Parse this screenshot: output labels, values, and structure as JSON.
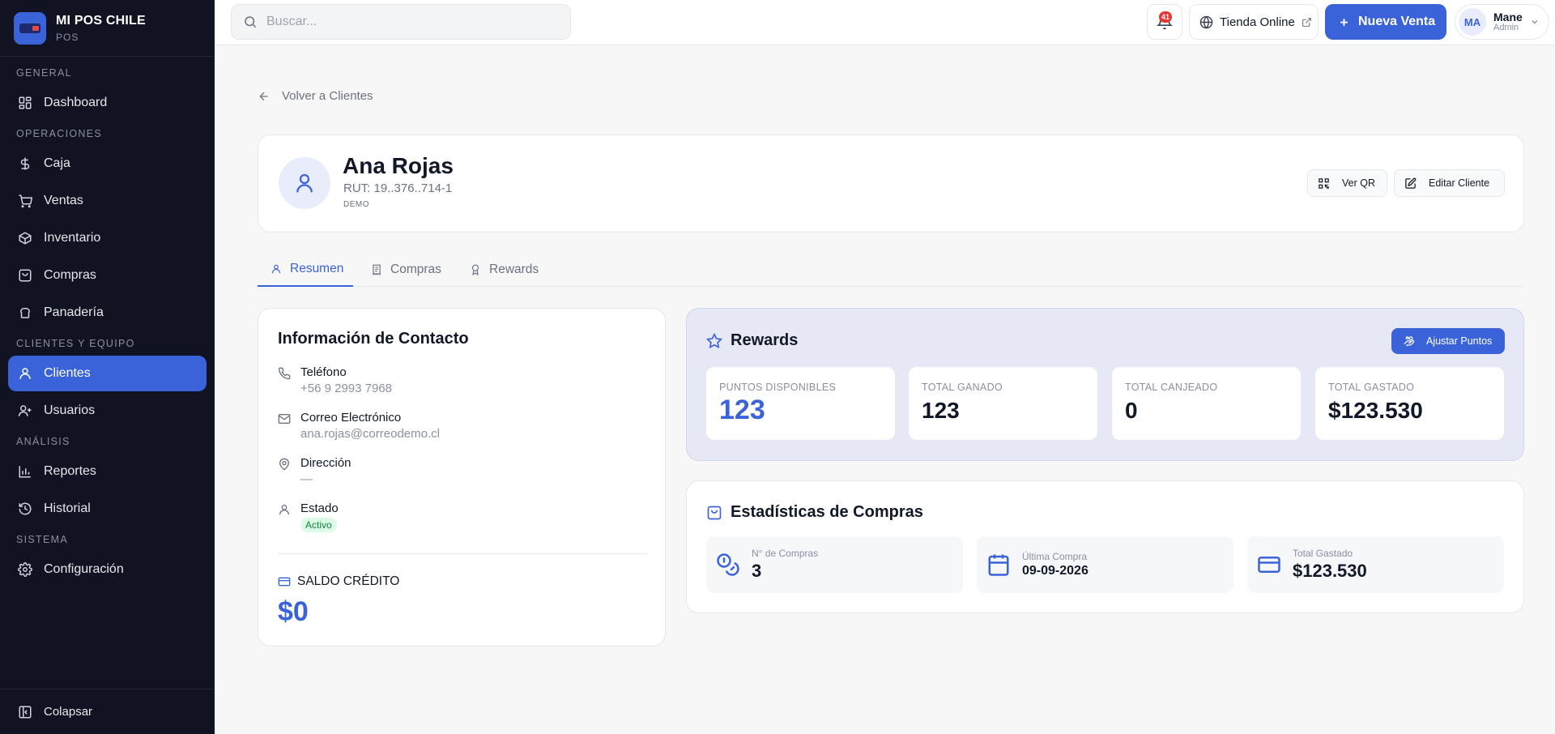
{
  "brand": {
    "name": "MI POS CHILE",
    "subtitle": "POS"
  },
  "sidebar": {
    "sections": [
      {
        "label": "GENERAL"
      },
      {
        "label": "OPERACIONES"
      },
      {
        "label": "CLIENTES Y EQUIPO"
      },
      {
        "label": "ANÁLISIS"
      },
      {
        "label": "SISTEMA"
      }
    ],
    "items": [
      {
        "label": "Dashboard",
        "icon": "dashboard-icon"
      },
      {
        "label": "Caja",
        "icon": "dollar-icon"
      },
      {
        "label": "Ventas",
        "icon": "cart-icon"
      },
      {
        "label": "Inventario",
        "icon": "box-icon"
      },
      {
        "label": "Compras",
        "icon": "shopping-bag-icon"
      },
      {
        "label": "Panadería",
        "icon": "bread-icon"
      },
      {
        "label": "Clientes",
        "icon": "user-icon",
        "active": true
      },
      {
        "label": "Usuarios",
        "icon": "users-icon"
      },
      {
        "label": "Reportes",
        "icon": "chart-icon"
      },
      {
        "label": "Historial",
        "icon": "history-icon"
      },
      {
        "label": "Configuración",
        "icon": "gear-icon"
      }
    ],
    "collapse_label": "Colapsar"
  },
  "topbar": {
    "search_placeholder": "Buscar...",
    "notification_count": "41",
    "store_label": "Tienda Online",
    "new_sale_label": "Nueva Venta",
    "user": {
      "initials": "MA",
      "name": "Mane",
      "role": "Admin"
    }
  },
  "back_label": "Volver a Clientes",
  "customer": {
    "name": "Ana Rojas",
    "rut": "RUT: 19..376..714-1",
    "tag": "DEMO",
    "qr_label": "Ver QR",
    "edit_label": "Editar Cliente"
  },
  "tabs": [
    {
      "label": "Resumen",
      "active": true
    },
    {
      "label": "Compras"
    },
    {
      "label": "Rewards"
    }
  ],
  "contact": {
    "title": "Información de Contacto",
    "phone_label": "Teléfono",
    "phone": "+56 9 2993 7968",
    "email_label": "Correo Electrónico",
    "email": "ana.rojas@correodemo.cl",
    "address_label": "Dirección",
    "address": "—",
    "status_label": "Estado",
    "status": "Activo",
    "credit_label": "SALDO CRÉDITO",
    "credit_value": "$0"
  },
  "rewards": {
    "title": "Rewards",
    "adjust_label": "Ajustar Puntos",
    "stats": [
      {
        "label": "PUNTOS DISPONIBLES",
        "value": "123"
      },
      {
        "label": "TOTAL GANADO",
        "value": "123"
      },
      {
        "label": "TOTAL CANJEADO",
        "value": "0"
      },
      {
        "label": "TOTAL GASTADO",
        "value": "$123.530"
      }
    ]
  },
  "purchase_stats": {
    "title": "Estadísticas de Compras",
    "items": [
      {
        "label": "N° de Compras",
        "value": "3"
      },
      {
        "label": "Última Compra",
        "value": "09-09-2026"
      },
      {
        "label": "Total Gastado",
        "value": "$123.530"
      }
    ]
  },
  "colors": {
    "accent": "#3b63d9",
    "sidebar_bg": "#111322",
    "active_status_bg": "#dcfce7"
  }
}
